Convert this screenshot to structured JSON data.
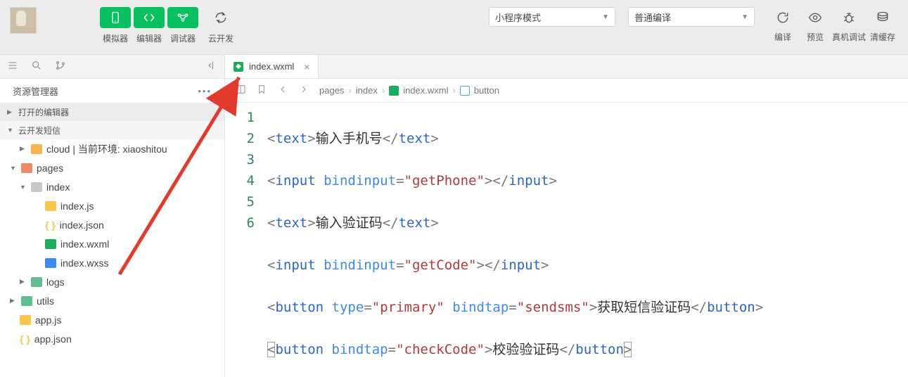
{
  "toolbar": {
    "simulator": "模拟器",
    "editor": "编辑器",
    "debugger": "调试器",
    "clouddev": "云开发",
    "mode_select": "小程序模式",
    "compile_select": "普通编译",
    "compile": "编译",
    "preview": "预览",
    "remote_debug": "真机调试",
    "clear_cache": "清缓存"
  },
  "sidebar": {
    "title": "资源管理器",
    "sections": {
      "open_editors": "打开的编辑器",
      "project": "云开发短信"
    },
    "tree": {
      "cloud": "cloud | 当前环境: xiaoshitou",
      "pages": "pages",
      "index": "index",
      "index_js": "index.js",
      "index_json": "index.json",
      "index_wxml": "index.wxml",
      "index_wxss": "index.wxss",
      "logs": "logs",
      "utils": "utils",
      "app_js": "app.js",
      "app_json": "app.json"
    }
  },
  "tab": {
    "name": "index.wxml"
  },
  "breadcrumb": {
    "p0": "pages",
    "p1": "index",
    "p2": "index.wxml",
    "p3": "button"
  },
  "code": {
    "lines": [
      "1",
      "2",
      "3",
      "4",
      "5",
      "6"
    ],
    "l1": {
      "tag": "text",
      "txt": "输入手机号"
    },
    "l2": {
      "tag": "input",
      "attr": "bindinput",
      "val": "getPhone"
    },
    "l3": {
      "tag": "text",
      "txt": "输入验证码"
    },
    "l4": {
      "tag": "input",
      "attr": "bindinput",
      "val": "getCode"
    },
    "l5": {
      "tag": "button",
      "a1": "type",
      "v1": "primary",
      "a2": "bindtap",
      "v2": "sendsms",
      "txt": "获取短信验证码"
    },
    "l6": {
      "tag": "button",
      "a1": "bindtap",
      "v1": "checkCode",
      "txt": "校验验证码"
    }
  }
}
